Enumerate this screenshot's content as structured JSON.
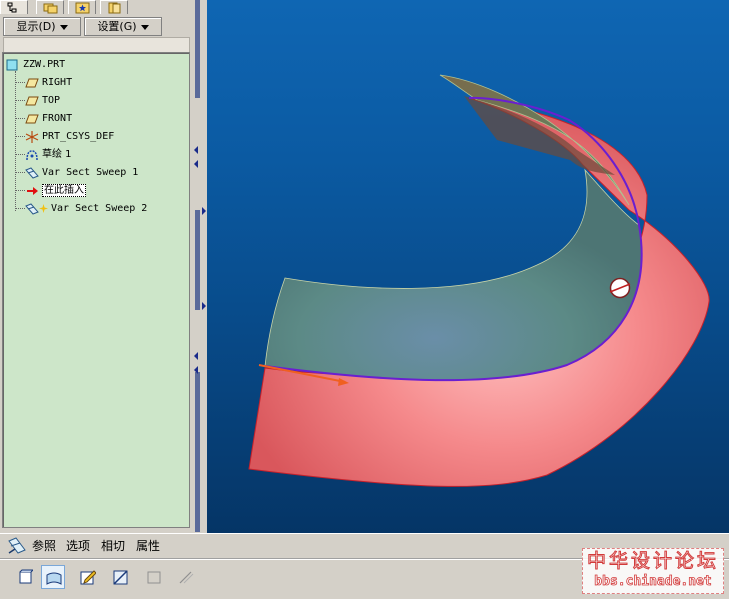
{
  "tabs": [
    {
      "name": "model-tree-tab",
      "icon": "tree-icon"
    },
    {
      "name": "folder-browser-tab",
      "icon": "folders-icon"
    },
    {
      "name": "favorites-tab",
      "icon": "star-icon"
    },
    {
      "name": "connections-tab",
      "icon": "pages-icon"
    }
  ],
  "menus": {
    "display": "显示(D)",
    "settings": "设置(G)"
  },
  "tree": {
    "root": "ZZW.PRT",
    "items": [
      {
        "label": "RIGHT",
        "icon": "datum-plane-icon"
      },
      {
        "label": "TOP",
        "icon": "datum-plane-icon"
      },
      {
        "label": "FRONT",
        "icon": "datum-plane-icon"
      },
      {
        "label": "PRT_CSYS_DEF",
        "icon": "csys-icon"
      },
      {
        "label": "草绘 1",
        "icon": "sketch-icon"
      },
      {
        "label": "Var Sect Sweep 1",
        "icon": "sweep-icon"
      },
      {
        "label": "在此插入",
        "icon": "insert-arrow-icon"
      },
      {
        "label": "Var Sect Sweep 2",
        "icon": "sweep-icon"
      }
    ]
  },
  "dashboard": {
    "tabs": [
      "参照",
      "选项",
      "相切",
      "属性"
    ],
    "tools": [
      "solid-icon",
      "surface-icon",
      "sketch-edit-icon",
      "remove-material-icon",
      "thicken-icon",
      "trim-icon"
    ]
  },
  "watermark": {
    "title": "中华设计论坛",
    "url": "bbs.chinade.net"
  },
  "colors": {
    "viewport_top": "#0f66b3",
    "viewport_bottom": "#053566",
    "tree_bg": "#cde6c9",
    "surface_pink": "#f07f82",
    "surface_teal": "#5c8a8a",
    "edge_purple": "#6a1fd0",
    "watermark_red": "#d23a3a"
  }
}
